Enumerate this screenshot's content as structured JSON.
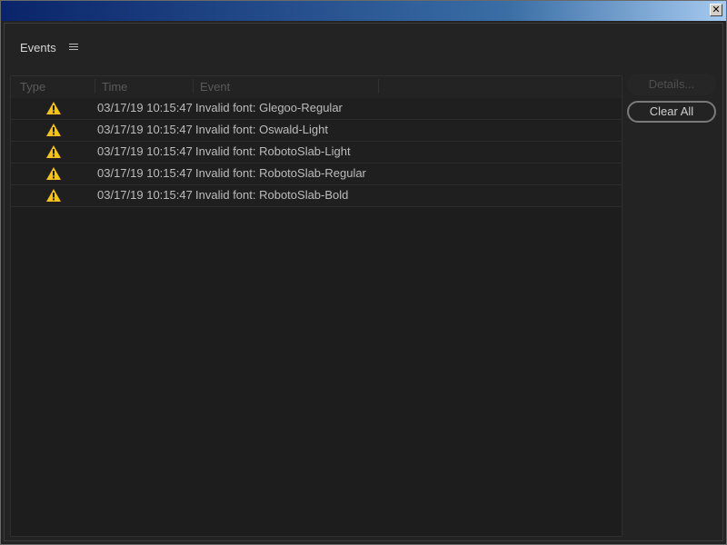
{
  "window": {
    "close_glyph": "✕"
  },
  "panel": {
    "title": "Events",
    "menu_icon": "hamburger-menu-icon"
  },
  "table": {
    "columns": [
      "Type",
      "Time",
      "Event"
    ],
    "rows": [
      {
        "type": "warning-icon",
        "time": "03/17/19 10:15:47",
        "event": "Invalid font: Glegoo-Regular"
      },
      {
        "type": "warning-icon",
        "time": "03/17/19 10:15:47",
        "event": "Invalid font: Oswald-Light"
      },
      {
        "type": "warning-icon",
        "time": "03/17/19 10:15:47",
        "event": "Invalid font: RobotoSlab-Light"
      },
      {
        "type": "warning-icon",
        "time": "03/17/19 10:15:47",
        "event": "Invalid font: RobotoSlab-Regular"
      },
      {
        "type": "warning-icon",
        "time": "03/17/19 10:15:47",
        "event": "Invalid font: RobotoSlab-Bold"
      }
    ]
  },
  "buttons": {
    "details": "Details...",
    "clear_all": "Clear All"
  },
  "colors": {
    "warning": "#f5c21b",
    "background": "#232323",
    "titlebar_start": "#0a246a",
    "titlebar_end": "#a6caf0"
  }
}
